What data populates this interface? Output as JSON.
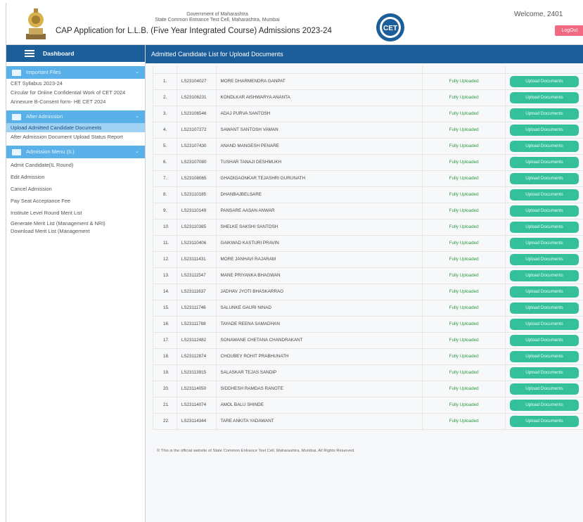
{
  "header": {
    "government": "Government of Maharashtra",
    "cell": "State Common Entrance Test Cell, Maharashtra, Mumbai",
    "app_title": "CAP Application for L.L.B. (Five Year Integrated Course) Admissions 2023-24",
    "logo_text": "CET",
    "welcome": "Welcome, 2401",
    "logout_label": "LogOut"
  },
  "sidebar": {
    "dashboard_label": "Dashboard",
    "sections": [
      {
        "title": "Important Files",
        "items": [
          {
            "label": "CET Syllabus 2023-24"
          },
          {
            "label": "Circular for Online Confidential Work of CET 2024"
          },
          {
            "label": "Annexure B-Consent form- HE CET 2024"
          }
        ]
      },
      {
        "title": "After Admission",
        "items": [
          {
            "label": "Upload Admitted Candidate Documents"
          },
          {
            "label": "After Admission Document Upload Status Report"
          }
        ]
      },
      {
        "title": "Admission Menu (IL)",
        "items": [
          {
            "label": "Admit Candidate(IL Round)"
          },
          {
            "label": "Edit Admission"
          },
          {
            "label": "Cancel Admission"
          },
          {
            "label": "Pay Seat Acceptance Fee"
          },
          {
            "label": "Institute Level Round Merit List"
          },
          {
            "label": "Generate Merit List (Management & NRI)"
          },
          {
            "label": "Download Merit List (Management"
          }
        ]
      }
    ]
  },
  "main": {
    "title": "Admitted Candidate List for Upload Documents",
    "button_label": "Upload Documents",
    "rows": [
      {
        "sr": "1.",
        "app": "LS23104027",
        "name": "MORE DHARMENDRA GANPAT",
        "status": "Fully Uploaded"
      },
      {
        "sr": "2.",
        "app": "LS23106231",
        "name": "KONDLKAR AISHWARYA ANANTA",
        "status": "Fully Uploaded"
      },
      {
        "sr": "3.",
        "app": "LS23106546",
        "name": "ADAJ PURVA SANTOSH",
        "status": "Fully Uploaded"
      },
      {
        "sr": "4.",
        "app": "LS23107272",
        "name": "SAWANT SANTOSH VAMAN",
        "status": "Fully Uploaded"
      },
      {
        "sr": "5.",
        "app": "LS23107430",
        "name": "ANAND MANGESH PENARE",
        "status": "Fully Uploaded"
      },
      {
        "sr": "6.",
        "app": "LS23107080",
        "name": "TUSHAR TANAJI DESHMUKH",
        "status": "Fully Uploaded"
      },
      {
        "sr": "7.",
        "app": "LS23108065",
        "name": "GHADIGAONKAR TEJASHRI GURUNATH",
        "status": "Fully Uploaded"
      },
      {
        "sr": "8.",
        "app": "LS23110185",
        "name": "DHANBAJBELSARE",
        "status": "Fully Uploaded"
      },
      {
        "sr": "9.",
        "app": "LS23110149",
        "name": "PANSARE AASAN ANWAR",
        "status": "Fully Uploaded"
      },
      {
        "sr": "10.",
        "app": "LS23110385",
        "name": "SHELKE SAKSHI SANTOSH",
        "status": "Fully Uploaded"
      },
      {
        "sr": "11.",
        "app": "LS23110406",
        "name": "GAIKWAD KASTURI PRAVIN",
        "status": "Fully Uploaded"
      },
      {
        "sr": "12.",
        "app": "LS23111431",
        "name": "MORE JANHAVI RAJARAM",
        "status": "Fully Uploaded"
      },
      {
        "sr": "13.",
        "app": "LS23111547",
        "name": "MANE PRIYANKA BHAGWAN",
        "status": "Fully Uploaded"
      },
      {
        "sr": "14.",
        "app": "LS23111637",
        "name": "JADHAV JYOTI BHASKARRAO",
        "status": "Fully Uploaded"
      },
      {
        "sr": "15.",
        "app": "LS23111746",
        "name": "SALUNKE GAURI NINAD",
        "status": "Fully Uploaded"
      },
      {
        "sr": "16.",
        "app": "LS23111788",
        "name": "TAYADE REENA SAMADHAN",
        "status": "Fully Uploaded"
      },
      {
        "sr": "17.",
        "app": "LS23112482",
        "name": "SONAWANE CHETANA CHANDRAKANT",
        "status": "Fully Uploaded"
      },
      {
        "sr": "18.",
        "app": "LS23112874",
        "name": "CHOUBEY ROHIT PRABHUNATH",
        "status": "Fully Uploaded"
      },
      {
        "sr": "19.",
        "app": "LS23113915",
        "name": "SALASKAR TEJAS SANDIP",
        "status": "Fully Uploaded"
      },
      {
        "sr": "20.",
        "app": "LS23114050",
        "name": "SIDDHESH RAMDAS RANOTE",
        "status": "Fully Uploaded"
      },
      {
        "sr": "21.",
        "app": "LS23114074",
        "name": "AMOL BALU SHINDE",
        "status": "Fully Uploaded"
      },
      {
        "sr": "22.",
        "app": "LS23114344",
        "name": "TARE ANKITA YADAWANT",
        "status": "Fully Uploaded"
      }
    ],
    "footer": "© This is the official website of State Common Entrance Test Cell, Maharashtra, Mumbai. All Rights Reserved."
  },
  "colors": {
    "primary": "#1b5e9a",
    "section": "#5ab0e8",
    "status": "#2e9a3e",
    "button": "#34c09a",
    "logout": "#f26a82"
  }
}
